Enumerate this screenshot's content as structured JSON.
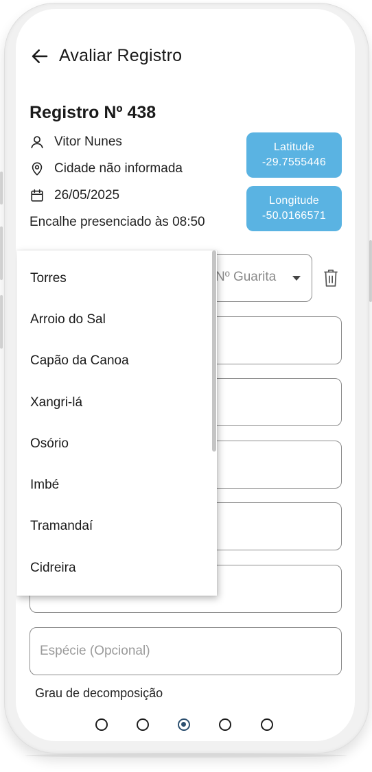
{
  "header": {
    "title": "Avaliar Registro"
  },
  "record": {
    "title": "Registro Nº 438",
    "user": "Vitor Nunes",
    "city": "Cidade não informada",
    "date": "26/05/2025",
    "note": "Encalhe presenciado às 08:50",
    "latitude_label": "Latitude",
    "latitude_value": "-29.7555446",
    "longitude_label": "Longitude",
    "longitude_value": "-50.0166571"
  },
  "form": {
    "guarita_placeholder": "Nº Guarita",
    "especie_placeholder": "Espécie (Opcional)",
    "decomposition_label": "Grau de decomposição",
    "decomposition_selected_index": 2,
    "decomposition_options_count": 5
  },
  "dropdown": {
    "items": [
      "Torres",
      "Arroio do Sal",
      "Capão da Canoa",
      "Xangri-lá",
      "Osório",
      "Imbé",
      "Tramandaí",
      "Cidreira"
    ]
  },
  "icons": {
    "back": "arrow-left-icon",
    "user": "user-icon",
    "location": "location-pin-icon",
    "calendar": "calendar-icon",
    "delete": "trash-icon"
  },
  "colors": {
    "accent": "#5ab3e2",
    "radio_selected": "#2c4f6f"
  }
}
